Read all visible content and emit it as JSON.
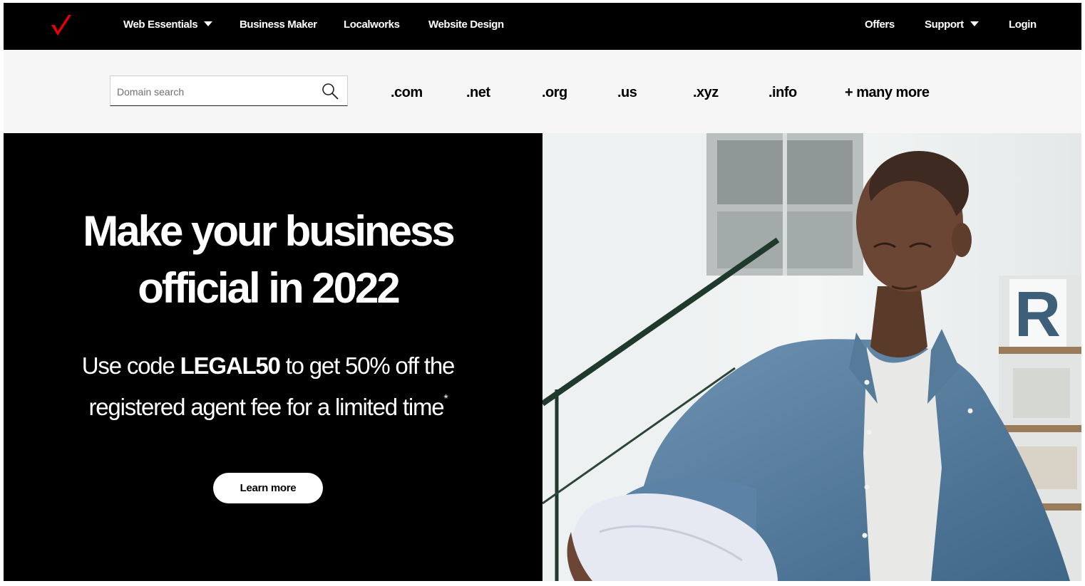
{
  "nav": {
    "logo_icon": "verizon-checkmark-icon",
    "left_items": [
      {
        "label": "Web Essentials",
        "dropdown": true
      },
      {
        "label": "Business Maker"
      },
      {
        "label": "Localworks"
      },
      {
        "label": "Website Design"
      }
    ],
    "right_items": [
      {
        "label": "Offers"
      },
      {
        "label": "Support",
        "dropdown": true
      },
      {
        "label": "Login"
      }
    ]
  },
  "domain_search": {
    "placeholder": "Domain search",
    "value": "",
    "icon": "search-icon",
    "tlds": [
      ".com",
      ".net",
      ".org",
      ".us",
      ".xyz",
      ".info",
      "+ many more"
    ]
  },
  "hero": {
    "title_line1": "Make your business",
    "title_line2": "official in 2022",
    "subtitle_part1": "Use code ",
    "promo_code": "LEGAL50",
    "subtitle_part2": " to get 50% off the",
    "subtitle_line2": "registered agent fee for a limited time",
    "footnote_mark": "*",
    "cta_label": "Learn more"
  },
  "colors": {
    "brand_red": "#ee0000",
    "nav_bg": "#000000",
    "domainbar_bg": "#f6f6f6",
    "hero_bg": "#000000"
  }
}
